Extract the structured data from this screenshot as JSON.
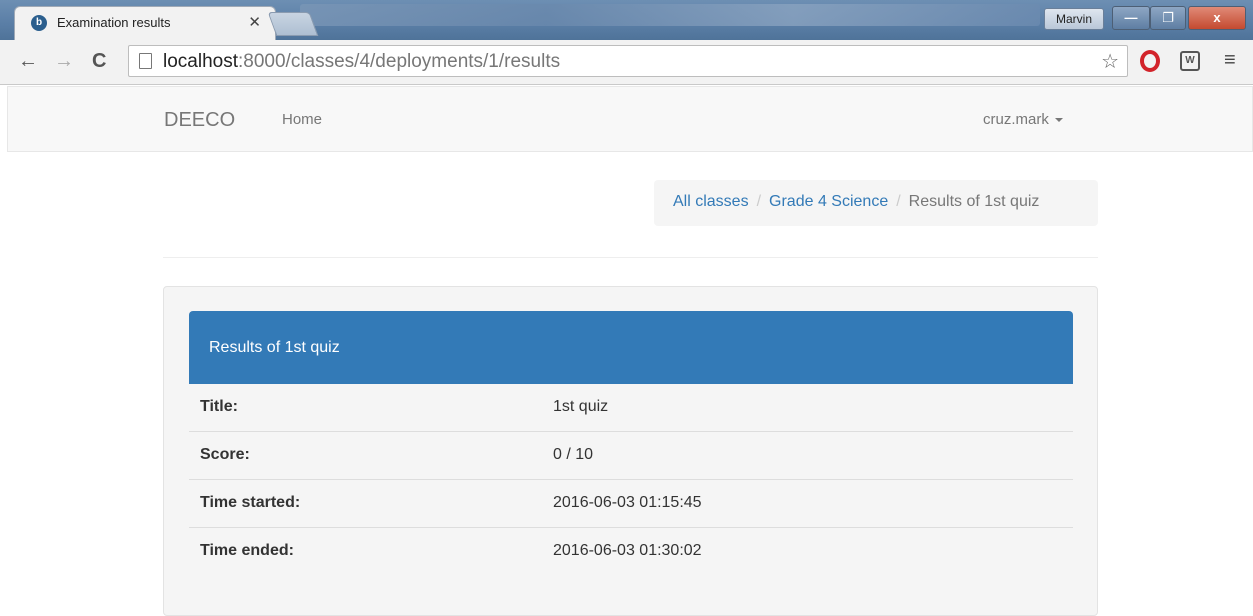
{
  "browser": {
    "tab_title": "Examination results",
    "tab_close": "✕",
    "user_badge": "Marvin",
    "url_host": "localhost",
    "url_rest": ":8000/classes/4/deployments/1/results",
    "window_min": "—",
    "window_max": "❐",
    "window_close": "x"
  },
  "navbar": {
    "brand": "DEECO",
    "home": "Home",
    "user": "cruz.mark"
  },
  "breadcrumb": {
    "items": [
      "All classes",
      "Grade 4 Science",
      "Results of 1st quiz"
    ],
    "separator": "/"
  },
  "results": {
    "heading": "Results of 1st quiz",
    "rows": [
      {
        "label": "Title:",
        "value": "1st quiz"
      },
      {
        "label": "Score:",
        "value": "0 / 10"
      },
      {
        "label": "Time started:",
        "value": "2016-06-03 01:15:45"
      },
      {
        "label": "Time ended:",
        "value": "2016-06-03 01:30:02"
      }
    ]
  },
  "colors": {
    "primary": "#337ab7",
    "navbar_bg": "#f8f8f8",
    "well_bg": "#f5f5f5"
  }
}
